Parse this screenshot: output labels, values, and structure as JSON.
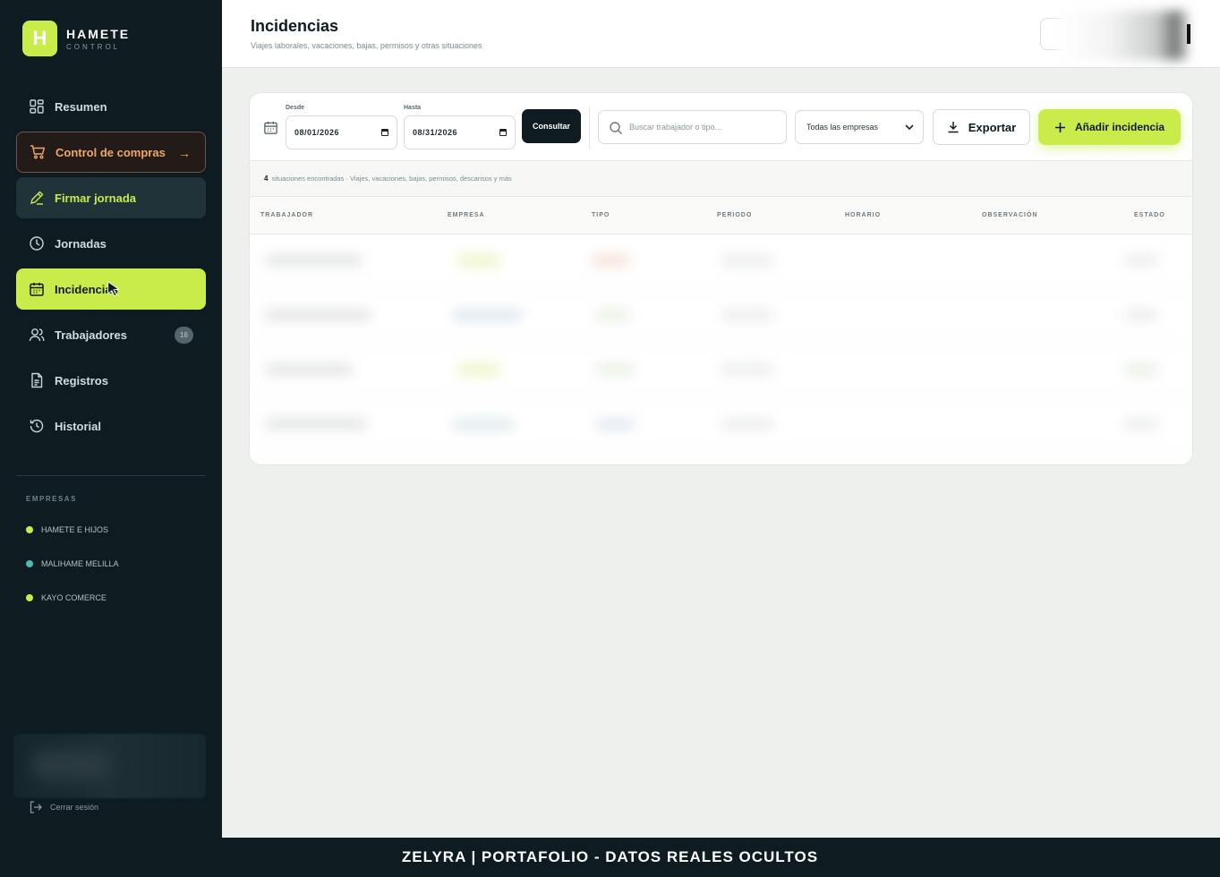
{
  "brand": {
    "logo_letter": "H",
    "name": "HAMETE",
    "subtitle": "CONTROL"
  },
  "sidebar": {
    "items": [
      {
        "label": "Resumen",
        "icon": "grid-icon"
      },
      {
        "label": "Control de compras",
        "icon": "cart-icon"
      },
      {
        "label": "Firmar jornada",
        "icon": "pen-icon"
      },
      {
        "label": "Jornadas",
        "icon": "clock-icon"
      },
      {
        "label": "Incidencias",
        "icon": "calendar-icon",
        "active": true
      },
      {
        "label": "Trabajadores",
        "icon": "users-icon",
        "badge": "16"
      },
      {
        "label": "Registros",
        "icon": "document-icon"
      },
      {
        "label": "Historial",
        "icon": "history-icon"
      }
    ],
    "empresas_title": "EMPRESAS",
    "empresas": [
      {
        "name": "HAMETE E HIJOS",
        "color": "#c9ec4a"
      },
      {
        "name": "MALIHAME MELILLA",
        "color": "#4fb8b0"
      },
      {
        "name": "KAYO COMERCE",
        "color": "#c9ec4a"
      }
    ],
    "logout_label": "Cerrar sesión"
  },
  "header": {
    "title": "Incidencias",
    "subtitle": "Viajes laborales, vacaciones, bajas, permisos y otras situaciones"
  },
  "toolbar": {
    "desde_label": "Desde",
    "desde_value": "08/01/2026",
    "hasta_label": "Hasta",
    "hasta_value": "08/31/2026",
    "consultar_label": "Consultar",
    "search_placeholder": "Buscar trabajador o tipo...",
    "empresa_select": "Todas las empresas",
    "export_label": "Exportar",
    "add_label": "Añadir incidencia"
  },
  "summary": {
    "count": "4",
    "text": "situaciones encontradas · Viajes, vacaciones, bajas, permisos, descansos y más"
  },
  "table": {
    "columns": [
      "TRABAJADOR",
      "EMPRESA",
      "TIPO",
      "PERIODO",
      "HORARIO",
      "OBSERVACIÓN",
      "ESTADO"
    ]
  },
  "footer": {
    "text": "ZELYRA | PORTAFOLIO - DATOS REALES OCULTOS"
  },
  "colors": {
    "accent": "#c9ec4a",
    "sidebar_bg": "#0e1c22",
    "compras_text": "#f0a76a"
  }
}
